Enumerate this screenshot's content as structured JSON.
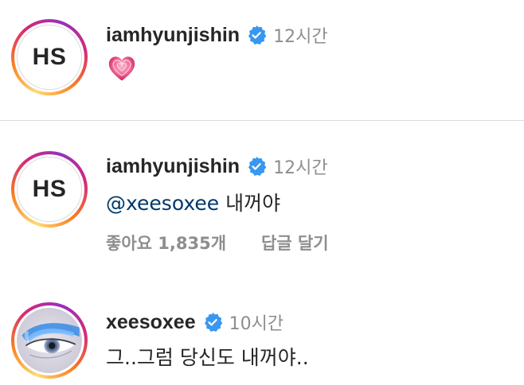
{
  "comments": [
    {
      "avatar_initials": "HS",
      "username": "iamhyunjishin",
      "verified": true,
      "time": "12시간",
      "content_emoji": "heart-emoji"
    },
    {
      "avatar_initials": "HS",
      "username": "iamhyunjishin",
      "verified": true,
      "time": "12시간",
      "mention": "@xeesoxee",
      "text": "내꺼야",
      "likes": "좋아요 1,835개",
      "reply_label": "답글 달기"
    },
    {
      "username": "xeesoxee",
      "verified": true,
      "time": "10시간",
      "text": "그..그럼 당신도 내꺼야.."
    }
  ],
  "colors": {
    "verified_badge": "#3897f0",
    "mention": "#00376b",
    "secondary_text": "#8e8e8e",
    "primary_text": "#262626",
    "heart": "#f06292"
  }
}
